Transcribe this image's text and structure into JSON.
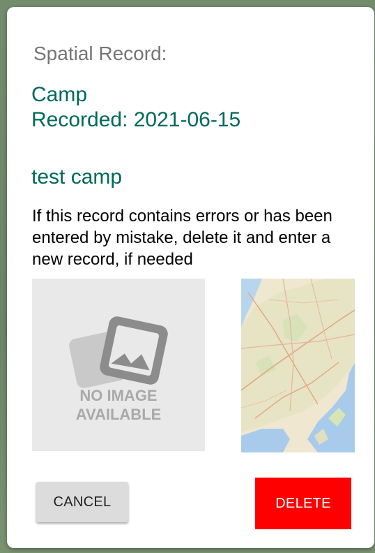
{
  "dialog": {
    "title": "Spatial Record:",
    "record_type": "Camp",
    "recorded_date": "Recorded: 2021-06-15",
    "record_name": "test camp",
    "warning": "If this record contains errors or has been entered by mistake, delete it and enter a new record, if needed"
  },
  "media": {
    "no_image_line1": "NO IMAGE",
    "no_image_line2": "AVAILABLE",
    "no_image_icon": "image-placeholder-icon",
    "map_preview": "map-thumbnail"
  },
  "actions": {
    "cancel_label": "CANCEL",
    "delete_label": "DELETE"
  },
  "colors": {
    "accent_text": "#00695c",
    "delete": "#ff0000",
    "cancel_bg": "#dcdcdc"
  }
}
